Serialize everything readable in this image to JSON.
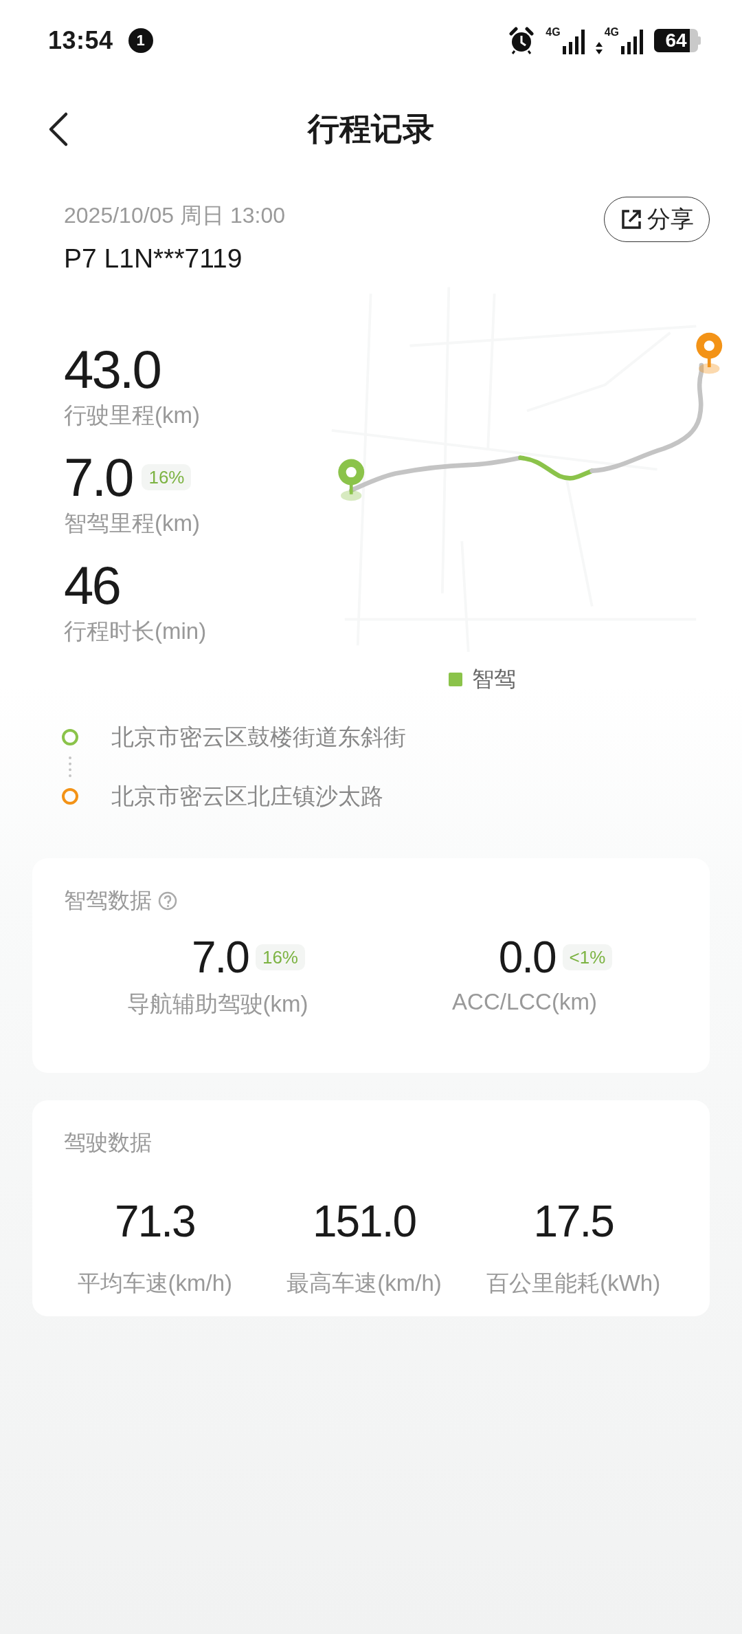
{
  "status_bar": {
    "time": "13:54",
    "notification_count": "1",
    "signals": [
      {
        "label": "4G",
        "kind": "plain"
      },
      {
        "label": "4G",
        "kind": "data"
      }
    ],
    "battery": "64"
  },
  "header": {
    "title": "行程记录"
  },
  "trip": {
    "datetime": "2025/10/05 周日 13:00",
    "vehicle": "P7 L1N***7119",
    "share_button": "分享",
    "stats": [
      {
        "value": "43.0",
        "label": "行驶里程(km)"
      },
      {
        "value": "7.0",
        "badge": "16%",
        "label": "智驾里程(km)"
      },
      {
        "value": "46",
        "label": "行程时长(min)"
      }
    ],
    "map_legend": {
      "label": "智驾",
      "color": "#8bc34a"
    },
    "route": [
      {
        "address": "北京市密云区鼓楼街道东斜街",
        "color": "#8bc34a"
      },
      {
        "address": "北京市密云区北庄镇沙太路",
        "color": "#f39317"
      }
    ]
  },
  "smart_driving": {
    "title": "智驾数据",
    "metrics": [
      {
        "value": "7.0",
        "badge": "16%",
        "label": "导航辅助驾驶(km)"
      },
      {
        "value": "0.0",
        "badge": "<1%",
        "label": "ACC/LCC(km)"
      }
    ]
  },
  "driving": {
    "title": "驾驶数据",
    "metrics": [
      {
        "value": "71.3",
        "label": "平均车速(km/h)"
      },
      {
        "value": "151.0",
        "label": "最高车速(km/h)"
      },
      {
        "value": "17.5",
        "label": "百公里能耗(kWh)"
      }
    ]
  }
}
